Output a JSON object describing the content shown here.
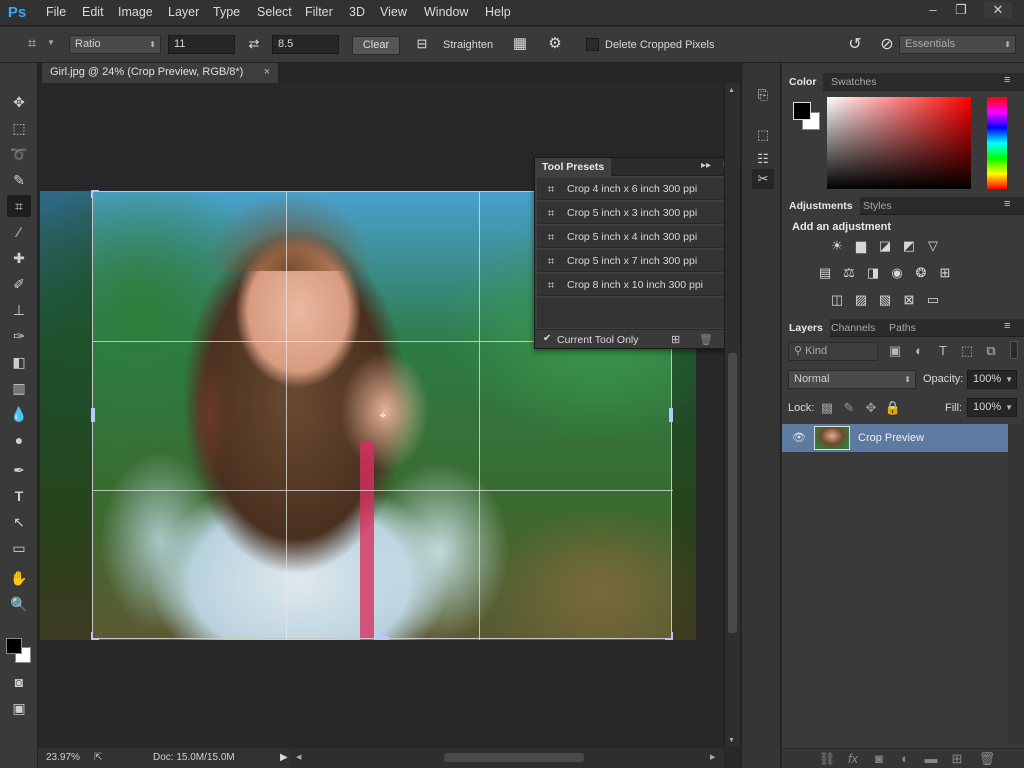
{
  "app": {
    "logo": "Ps"
  },
  "menu": [
    "File",
    "Edit",
    "Image",
    "Layer",
    "Type",
    "Select",
    "Filter",
    "3D",
    "View",
    "Window",
    "Help"
  ],
  "window_controls": {
    "minimize": "–",
    "restore": "❐",
    "close": "✕"
  },
  "options": {
    "mode": "Ratio",
    "width": "11",
    "swap_icon": "swap-arrows-icon",
    "height": "8.5",
    "clear_label": "Clear",
    "straighten_label": "Straighten",
    "delete_cropped": "Delete Cropped Pixels",
    "workspace": "Essentials"
  },
  "document": {
    "tab_title": "Girl.jpg @ 24% (Crop Preview, RGB/8*)",
    "tab_close": "×"
  },
  "status": {
    "zoom": "23.97%",
    "doc": "Doc: 15.0M/15.0M"
  },
  "tool_presets": {
    "title": "Tool Presets",
    "items": [
      "Crop 4 inch x 6 inch 300 ppi",
      "Crop 5 inch x 3 inch 300 ppi",
      "Crop 5 inch x 4 inch 300 ppi",
      "Crop 5 inch x 7 inch 300 ppi",
      "Crop 8 inch x 10 inch 300 ppi"
    ],
    "current_tool_only": "Current Tool Only",
    "checkmark": "✔"
  },
  "panels": {
    "color_tabs": [
      "Color",
      "Swatches"
    ],
    "adjust_tabs": [
      "Adjustments",
      "Styles"
    ],
    "add_adjustment": "Add an adjustment",
    "layers_tabs": [
      "Layers",
      "Channels",
      "Paths"
    ],
    "kind": "Kind",
    "blend_mode": "Normal",
    "opacity_label": "Opacity:",
    "opacity_value": "100%",
    "lock_label": "Lock:",
    "fill_label": "Fill:",
    "fill_value": "100%",
    "layer_name": "Crop Preview"
  },
  "colors": {
    "accent": "#5d7aa1",
    "foreground": "#000000",
    "background": "#ffffff"
  }
}
